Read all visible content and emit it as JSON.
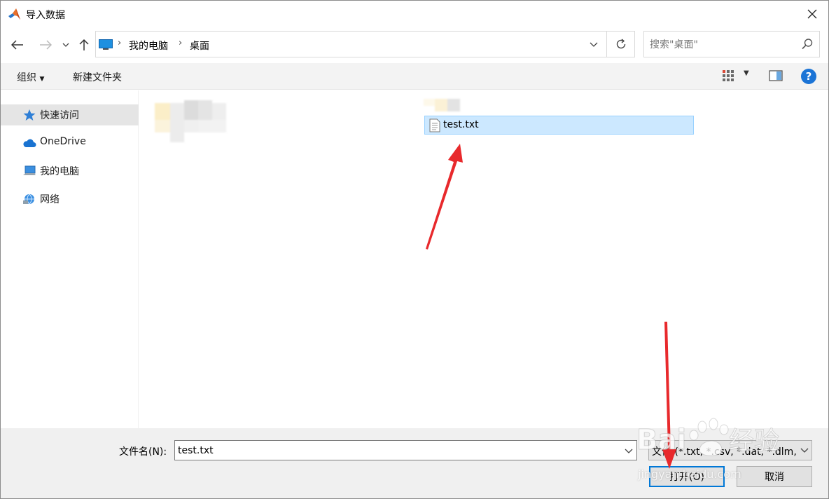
{
  "window": {
    "title": "导入数据",
    "close_icon": "close-icon",
    "app_icon": "matlab-logo-icon"
  },
  "navigation": {
    "back_icon": "arrow-left-icon",
    "forward_icon": "arrow-right-icon",
    "recent_icon": "chevron-down-icon",
    "up_icon": "arrow-up-icon"
  },
  "address_bar": {
    "breadcrumbs": [
      "我的电脑",
      "桌面"
    ],
    "refresh_icon": "refresh-icon"
  },
  "search": {
    "placeholder": "搜索\"桌面\""
  },
  "toolbar": {
    "organize_label": "组织",
    "new_folder_label": "新建文件夹"
  },
  "sidebar": {
    "items": [
      {
        "label": "快速访问",
        "icon": "star-icon",
        "selected": true
      },
      {
        "label": "OneDrive",
        "icon": "cloud-icon",
        "selected": false
      },
      {
        "label": "我的电脑",
        "icon": "computer-icon",
        "selected": false
      },
      {
        "label": "网络",
        "icon": "network-icon",
        "selected": false
      }
    ]
  },
  "files": [
    {
      "name": "test.txt",
      "icon": "text-file-icon",
      "selected": true
    }
  ],
  "bottom": {
    "filename_label": "文件名(N):",
    "filename_value": "test.txt",
    "filter_value": "文件 (*.txt, *.csv, *.dat, *.dlm,",
    "open_label": "打开(O)",
    "cancel_label": "取消"
  },
  "watermark": {
    "text": "jingyan.baidu.com"
  },
  "colors": {
    "selection": "#cce8ff",
    "selection_border": "#99d1ff",
    "accent": "#0078d7",
    "annotation_arrow": "#e8292c"
  }
}
